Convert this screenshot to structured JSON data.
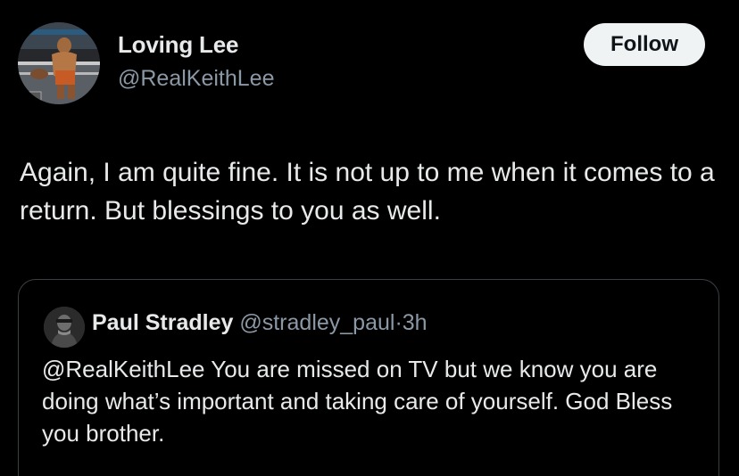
{
  "tweet": {
    "author": {
      "name": "Loving Lee",
      "handle": "@RealKeithLee"
    },
    "follow_label": "Follow",
    "text": "Again, I am quite fine. It is not up to me when it comes to a return. But blessings to you as well."
  },
  "quote": {
    "author": {
      "name": "Paul Stradley",
      "handle": "@stradley_paul",
      "separator": "·",
      "time": "3h"
    },
    "text": "@RealKeithLee You are missed on TV but we know you are doing what’s important and taking care of yourself. God Bless you brother."
  },
  "colors": {
    "background": "#000000",
    "primary_text": "#e7e9ea",
    "secondary_text": "#8b98a5",
    "follow_bg": "#eff3f4",
    "card_border": "#3a3f44"
  }
}
